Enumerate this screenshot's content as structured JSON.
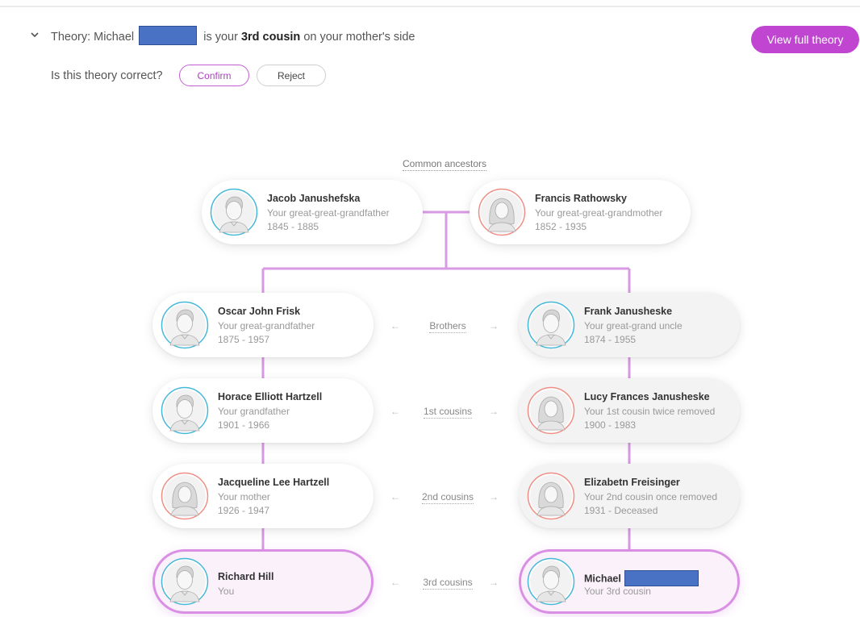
{
  "theory": {
    "prefix": "Theory: Michael",
    "middle": "is your",
    "relation": "3rd cousin",
    "suffix": "on your mother's side",
    "question": "Is this theory correct?",
    "confirm_label": "Confirm",
    "reject_label": "Reject",
    "view_full_label": "View full theory"
  },
  "tree": {
    "common_ancestors_label": "Common ancestors",
    "ancestors": [
      {
        "name": "Jacob Janushefska",
        "relation": "Your great-great-grandfather",
        "dates": "1845 - 1885",
        "gender": "male"
      },
      {
        "name": "Francis Rathowsky",
        "relation": "Your great-great-grandmother",
        "dates": "1852 - 1935",
        "gender": "female"
      }
    ],
    "left": [
      {
        "name": "Oscar John Frisk",
        "relation": "Your great-grandfather",
        "dates": "1875 - 1957",
        "gender": "male"
      },
      {
        "name": "Horace Elliott Hartzell",
        "relation": "Your grandfather",
        "dates": "1901 - 1966",
        "gender": "male"
      },
      {
        "name": "Jacqueline Lee Hartzell",
        "relation": "Your mother",
        "dates": "1926 - 1947",
        "gender": "female"
      },
      {
        "name": "Richard Hill",
        "relation": "You",
        "dates": "",
        "gender": "male"
      }
    ],
    "right": [
      {
        "name": "Frank Janusheske",
        "relation": "Your great-grand uncle",
        "dates": "1874 - 1955",
        "gender": "male"
      },
      {
        "name": "Lucy Frances Janusheske",
        "relation": "Your 1st cousin twice removed",
        "dates": "1900 - 1983",
        "gender": "female"
      },
      {
        "name": "Elizabetn Freisinger",
        "relation": "Your 2nd cousin once removed",
        "dates": "1931 - Deceased",
        "gender": "female"
      },
      {
        "name": "Michael",
        "relation": "Your 3rd cousin",
        "dates": "",
        "gender": "male"
      }
    ],
    "relations": [
      "Brothers",
      "1st cousins",
      "2nd cousins",
      "3rd cousins"
    ],
    "arrow_left": "←",
    "arrow_right": "→"
  },
  "colors": {
    "accent": "#c046d1",
    "male_ring": "#45b8d8",
    "female_ring": "#ef8e84",
    "connector": "#d89ae2"
  }
}
